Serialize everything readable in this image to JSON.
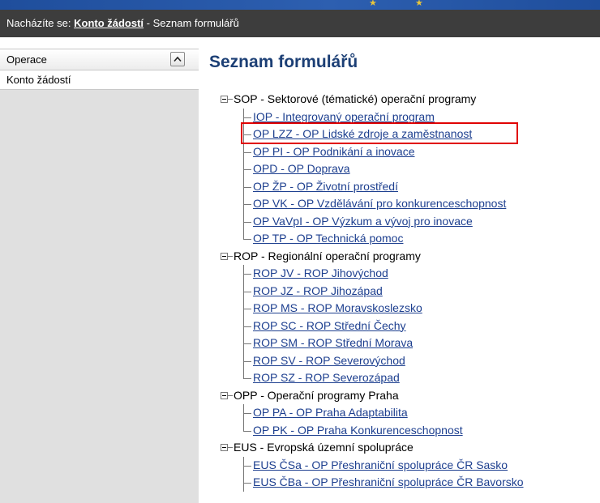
{
  "breadcrumb": {
    "prefix": "Nacházíte se: ",
    "link": "Konto žádostí",
    "suffix": " - Seznam formulářů"
  },
  "sidebar": {
    "header": "Operace",
    "items": [
      "Konto žádostí"
    ]
  },
  "page_title": "Seznam formulářů",
  "tree": {
    "groups": [
      {
        "label": "SOP - Sektorové (tématické) operační programy",
        "items": [
          "IOP - Integrovaný operační program",
          "OP LZZ - OP Lidské zdroje a zaměstnanost",
          "OP PI - OP Podnikání a inovace",
          "OPD - OP Doprava",
          "OP ŽP - OP Životní prostředí",
          "OP VK - OP Vzdělávání pro konkurenceschopnost",
          "OP VaVpI - OP Výzkum a vývoj pro inovace",
          "OP TP - OP Technická pomoc"
        ]
      },
      {
        "label": "ROP - Regionální operační programy",
        "items": [
          "ROP JV - ROP Jihovýchod",
          "ROP JZ - ROP Jihozápad",
          "ROP MS - ROP Moravskoslezsko",
          "ROP SC - ROP Střední Čechy",
          "ROP SM - ROP Střední Morava",
          "ROP SV - ROP Severovýchod",
          "ROP SZ - ROP Severozápad"
        ]
      },
      {
        "label": "OPP - Operační programy Praha",
        "items": [
          "OP PA - OP Praha Adaptabilita",
          "OP PK - OP Praha Konkurenceschopnost"
        ]
      },
      {
        "label": "EUS - Evropská územní spolupráce",
        "items": [
          "EUS ČSa - OP Přeshraniční spolupráce ČR Sasko",
          "EUS ČBa - OP Přeshraniční spolupráce ČR Bavorsko"
        ]
      }
    ]
  },
  "colors": {
    "breadcrumb_bg": "#3d3d3d",
    "title": "#1c3f75",
    "link": "#1d3f8f",
    "highlight": "#e00000"
  }
}
